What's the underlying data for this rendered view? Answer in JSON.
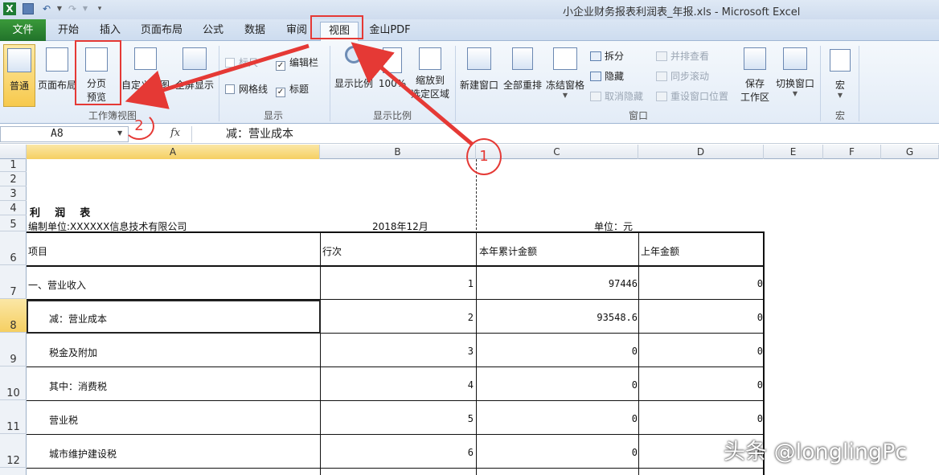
{
  "window": {
    "title": "小企业财务报表利润表_年报.xls  -  Microsoft Excel"
  },
  "tabs": [
    "文件",
    "开始",
    "插入",
    "页面布局",
    "公式",
    "数据",
    "审阅",
    "视图",
    "金山PDF"
  ],
  "ribbon": {
    "workbook_views": {
      "label": "工作簿视图",
      "normal": "普通",
      "page_layout": "页面布局",
      "page_break_1": "分页",
      "page_break_2": "预览",
      "custom_view": "自定义视图",
      "fullscreen": "全屏显示"
    },
    "show": {
      "label": "显示",
      "ruler": "标尺",
      "gridlines": "网格线",
      "formula_bar": "编辑栏",
      "headings": "标题"
    },
    "zoom": {
      "label": "显示比例",
      "zoom": "显示比例",
      "hundred": "100%",
      "zoom_sel_1": "缩放到",
      "zoom_sel_2": "选定区域"
    },
    "window": {
      "label": "窗口",
      "new_window": "新建窗口",
      "arrange_all": "全部重排",
      "freeze": "冻结窗格",
      "split": "拆分",
      "hide": "隐藏",
      "unhide": "取消隐藏",
      "side_by_side": "并排查看",
      "sync_scroll": "同步滚动",
      "reset_pos": "重设窗口位置",
      "save_ws_1": "保存",
      "save_ws_2": "工作区",
      "switch": "切换窗口"
    },
    "macros": {
      "label": "宏",
      "macro": "宏"
    }
  },
  "formula_bar": {
    "name_box": "A8",
    "fx": "fx",
    "content": "减：营业成本"
  },
  "columns": [
    "A",
    "B",
    "C",
    "D",
    "E",
    "F",
    "G"
  ],
  "rows": [
    "1",
    "2",
    "3",
    "4",
    "5",
    "6",
    "7",
    "8",
    "9",
    "10",
    "11",
    "12"
  ],
  "sheet": {
    "title": "利    润    表",
    "unit_name": "编制单位:XXXXXX信息技术有限公司",
    "period": "2018年12月",
    "unit": "单位：元",
    "headers": [
      "项目",
      "行次",
      "本年累计金额",
      "上年金额"
    ],
    "data_rows": [
      {
        "item": "一、营业收入",
        "line": "1",
        "current": "97446",
        "prior": "0"
      },
      {
        "item": "减：营业成本",
        "line": "2",
        "current": "93548.6",
        "prior": "0"
      },
      {
        "item": "税金及附加",
        "line": "3",
        "current": "0",
        "prior": "0"
      },
      {
        "item": "其中：消费税",
        "line": "4",
        "current": "0",
        "prior": "0"
      },
      {
        "item": "营业税",
        "line": "5",
        "current": "0",
        "prior": "0"
      },
      {
        "item": "城市维护建设税",
        "line": "6",
        "current": "0",
        "prior": "0"
      }
    ]
  },
  "annotations": {
    "step1": "1",
    "step2": "2"
  },
  "watermark": "头条 @longlingPc",
  "colors": {
    "file_tab": "#2b8a34",
    "annotation": "#e53935",
    "selection": "#f5cf62"
  }
}
